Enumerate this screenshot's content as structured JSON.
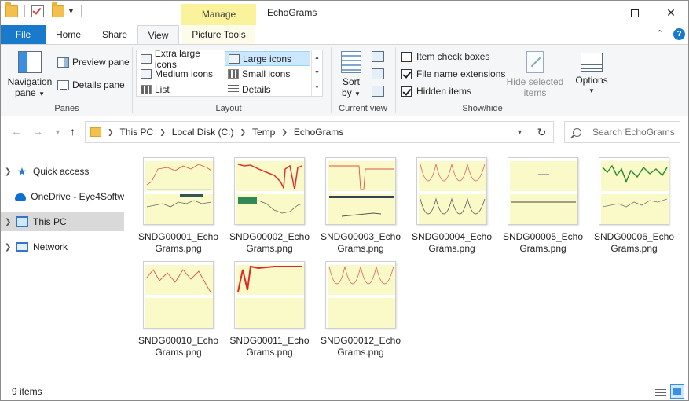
{
  "window": {
    "title": "EchoGrams",
    "manage_label": "Manage"
  },
  "tabs": [
    {
      "label": "File"
    },
    {
      "label": "Home"
    },
    {
      "label": "Share"
    },
    {
      "label": "View"
    },
    {
      "label": "Picture Tools"
    }
  ],
  "ribbon": {
    "panes": {
      "group_label": "Panes",
      "navigation_pane": "Navigation",
      "navigation_pane_2": "pane",
      "preview_pane": "Preview pane",
      "details_pane": "Details pane"
    },
    "layout": {
      "group_label": "Layout",
      "items": [
        {
          "label": "Extra large icons",
          "selected": false
        },
        {
          "label": "Large icons",
          "selected": true
        },
        {
          "label": "Medium icons",
          "selected": false
        },
        {
          "label": "Small icons",
          "selected": false
        },
        {
          "label": "List",
          "selected": false
        },
        {
          "label": "Details",
          "selected": false
        }
      ]
    },
    "current_view": {
      "group_label": "Current view",
      "sort_label": "Sort",
      "sort_label_2": "by"
    },
    "show_hide": {
      "group_label": "Show/hide",
      "item_check_boxes": {
        "label": "Item check boxes",
        "checked": false
      },
      "file_name_extensions": {
        "label": "File name extensions",
        "checked": true
      },
      "hidden_items": {
        "label": "Hidden items",
        "checked": true
      },
      "hide_selected": "Hide selected",
      "hide_selected_2": "items"
    },
    "options": {
      "label": "Options"
    }
  },
  "address": {
    "segments": [
      "This PC",
      "Local Disk (C:)",
      "Temp",
      "EchoGrams"
    ]
  },
  "search": {
    "placeholder": "Search EchoGrams"
  },
  "nav": {
    "items": [
      {
        "label": "Quick access",
        "icon": "star-icon",
        "selected": false
      },
      {
        "label": "OneDrive - Eye4Softw",
        "icon": "cloud-icon",
        "selected": false
      },
      {
        "label": "This PC",
        "icon": "computer-icon",
        "selected": true
      },
      {
        "label": "Network",
        "icon": "network-icon",
        "selected": false
      }
    ]
  },
  "files": [
    {
      "name": "SNDG00001_EchoGrams.png",
      "line1": "SNDG00001_Echo",
      "line2": "Grams.png"
    },
    {
      "name": "SNDG00002_EchoGrams.png",
      "line1": "SNDG00002_Echo",
      "line2": "Grams.png"
    },
    {
      "name": "SNDG00003_EchoGrams.png",
      "line1": "SNDG00003_Echo",
      "line2": "Grams.png"
    },
    {
      "name": "SNDG00004_EchoGrams.png",
      "line1": "SNDG00004_Echo",
      "line2": "Grams.png"
    },
    {
      "name": "SNDG00005_EchoGrams.png",
      "line1": "SNDG00005_Echo",
      "line2": "Grams.png"
    },
    {
      "name": "SNDG00006_EchoGrams.png",
      "line1": "SNDG00006_Echo",
      "line2": "Grams.png"
    },
    {
      "name": "SNDG00010_EchoGrams.png",
      "line1": "SNDG00010_Echo",
      "line2": "Grams.png"
    },
    {
      "name": "SNDG00011_EchoGrams.png",
      "line1": "SNDG00011_Echo",
      "line2": "Grams.png"
    },
    {
      "name": "SNDG00012_EchoGrams.png",
      "line1": "SNDG00012_Echo",
      "line2": "Grams.png"
    }
  ],
  "status": {
    "item_count": "9 items"
  },
  "colors": {
    "accent": "#1979ca",
    "manage_tab": "#faf39b",
    "selection": "#cce8ff"
  }
}
